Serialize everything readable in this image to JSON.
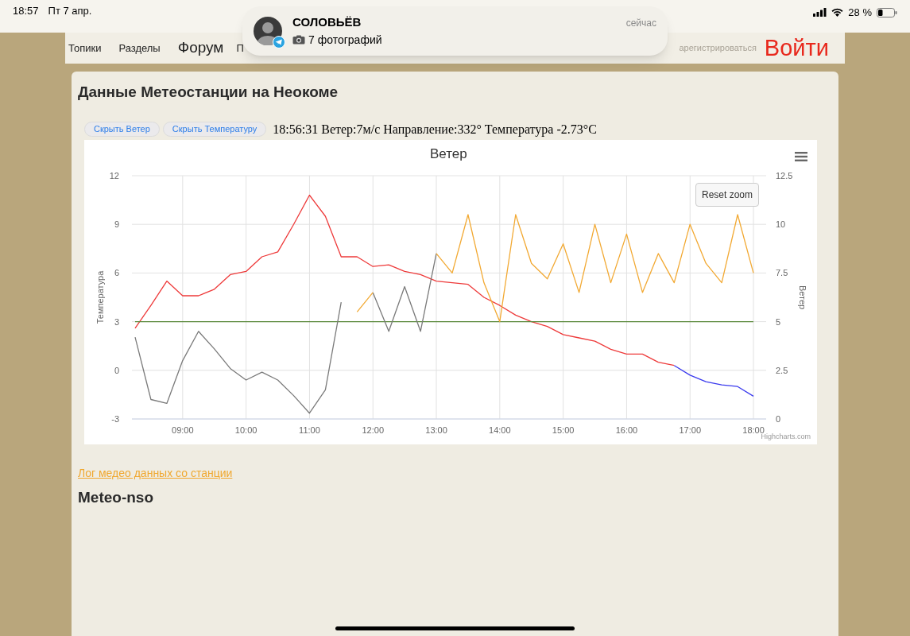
{
  "status_bar": {
    "time": "18:57",
    "date": "Пт 7 апр.",
    "battery": "28 %"
  },
  "notification": {
    "sender": "СОЛОВЬЁВ",
    "message": "7 фотографий",
    "time": "сейчас"
  },
  "nav": {
    "items": [
      {
        "label": "Топики",
        "kind": "small"
      },
      {
        "label": "Разделы",
        "kind": "small"
      },
      {
        "label": "Форум",
        "kind": "large"
      },
      {
        "label": "П",
        "kind": "small"
      }
    ],
    "register": "арегистрироваться",
    "login": "Войти"
  },
  "page": {
    "title": "Данные Метеостанции на Неокоме",
    "buttons": [
      "Скрыть Ветер",
      "Скрыть Температуру"
    ],
    "reading": "18:56:31 Ветер:7м/с Направление:332° Температура -2.73°C",
    "chart": {
      "reset_button": "Reset zoom",
      "credit": "Highcharts.com",
      "chart_data": {
        "type": "line",
        "title": "Ветер",
        "ylabel": "Температура",
        "y2label": "Ветер",
        "xlim": [
          8.2,
          18.2
        ],
        "ylim": [
          -3,
          12
        ],
        "y2lim": [
          0,
          12.5
        ],
        "xticks": [
          {
            "value": 9,
            "label": "09:00"
          },
          {
            "value": 10,
            "label": "10:00"
          },
          {
            "value": 11,
            "label": "11:00"
          },
          {
            "value": 12,
            "label": "12:00"
          },
          {
            "value": 13,
            "label": "13:00"
          },
          {
            "value": 14,
            "label": "14:00"
          },
          {
            "value": 15,
            "label": "15:00"
          },
          {
            "value": 16,
            "label": "16:00"
          },
          {
            "value": 17,
            "label": "17:00"
          },
          {
            "value": 18,
            "label": "18:00"
          }
        ],
        "yticks": [
          -3,
          0,
          3,
          6,
          9,
          12
        ],
        "y2ticks": [
          0,
          2.5,
          5,
          7.5,
          10,
          12.5
        ],
        "x": [
          8.25,
          8.5,
          8.75,
          9,
          9.25,
          9.5,
          9.75,
          10,
          10.25,
          10.5,
          10.75,
          11,
          11.25,
          11.5,
          11.75,
          12,
          12.25,
          12.5,
          12.75,
          13,
          13.25,
          13.5,
          13.75,
          14,
          14.25,
          14.5,
          14.75,
          15,
          15.25,
          15.5,
          15.75,
          16,
          16.25,
          16.5,
          16.75,
          17,
          17.25,
          17.5,
          17.75,
          18
        ],
        "series": [
          {
            "color": "#ee3a3a",
            "values": [
              2.6,
              4.0,
              5.5,
              4.6,
              4.6,
              5.0,
              5.9,
              6.1,
              7.0,
              7.3,
              9.0,
              10.8,
              9.5,
              7.0,
              7.0,
              6.4,
              6.5,
              6.1,
              5.9,
              5.5,
              5.4,
              5.3,
              4.5,
              4.0,
              3.4,
              3.0,
              2.7,
              2.2,
              2.0,
              1.8,
              1.3,
              1.0,
              1.0,
              0.5,
              0.3,
              null,
              null,
              null,
              null,
              null
            ]
          },
          {
            "color": "#3a3aee",
            "values": [
              null,
              null,
              null,
              null,
              null,
              null,
              null,
              null,
              null,
              null,
              null,
              null,
              null,
              null,
              null,
              null,
              null,
              null,
              null,
              null,
              null,
              null,
              null,
              null,
              null,
              null,
              null,
              null,
              null,
              null,
              null,
              null,
              null,
              null,
              0.3,
              -0.3,
              -0.7,
              -0.9,
              -1.0,
              -1.6
            ]
          },
          {
            "color": "#5b8a3c",
            "values": [
              3,
              3,
              3,
              3,
              3,
              3,
              3,
              3,
              3,
              3,
              3,
              3,
              3,
              3,
              3,
              3,
              3,
              3,
              3,
              3,
              3,
              3,
              3,
              3,
              3,
              3,
              3,
              3,
              3,
              3,
              3,
              3,
              3,
              3,
              3,
              3,
              3,
              3,
              3,
              3
            ]
          },
          {
            "color": "#7a7a7a",
            "axis": "y2",
            "values": [
              4.2,
              1.0,
              0.8,
              3.0,
              4.5,
              3.6,
              2.6,
              2.0,
              2.4,
              2.0,
              1.2,
              0.3,
              1.5,
              6.0,
              null,
              6.5,
              4.5,
              6.8,
              4.5,
              8.5,
              null,
              null,
              null,
              null,
              null,
              null,
              null,
              null,
              null,
              null,
              null,
              null,
              null,
              null,
              null,
              null,
              null,
              null,
              null,
              null
            ]
          },
          {
            "color": "#f2a933",
            "axis": "y2",
            "values": [
              null,
              null,
              null,
              null,
              null,
              null,
              null,
              null,
              null,
              null,
              null,
              null,
              null,
              null,
              5.5,
              6.5,
              null,
              null,
              null,
              8.5,
              7.5,
              10.5,
              7.0,
              5.0,
              10.5,
              8.0,
              7.2,
              9.0,
              6.5,
              10.0,
              7.0,
              9.5,
              6.5,
              8.5,
              7.0,
              10.0,
              8.0,
              7.0,
              10.5,
              7.5
            ]
          }
        ],
        "grid": true
      }
    },
    "log_link": "Лог медео данных со станции",
    "subtitle": "Meteo-nso"
  }
}
